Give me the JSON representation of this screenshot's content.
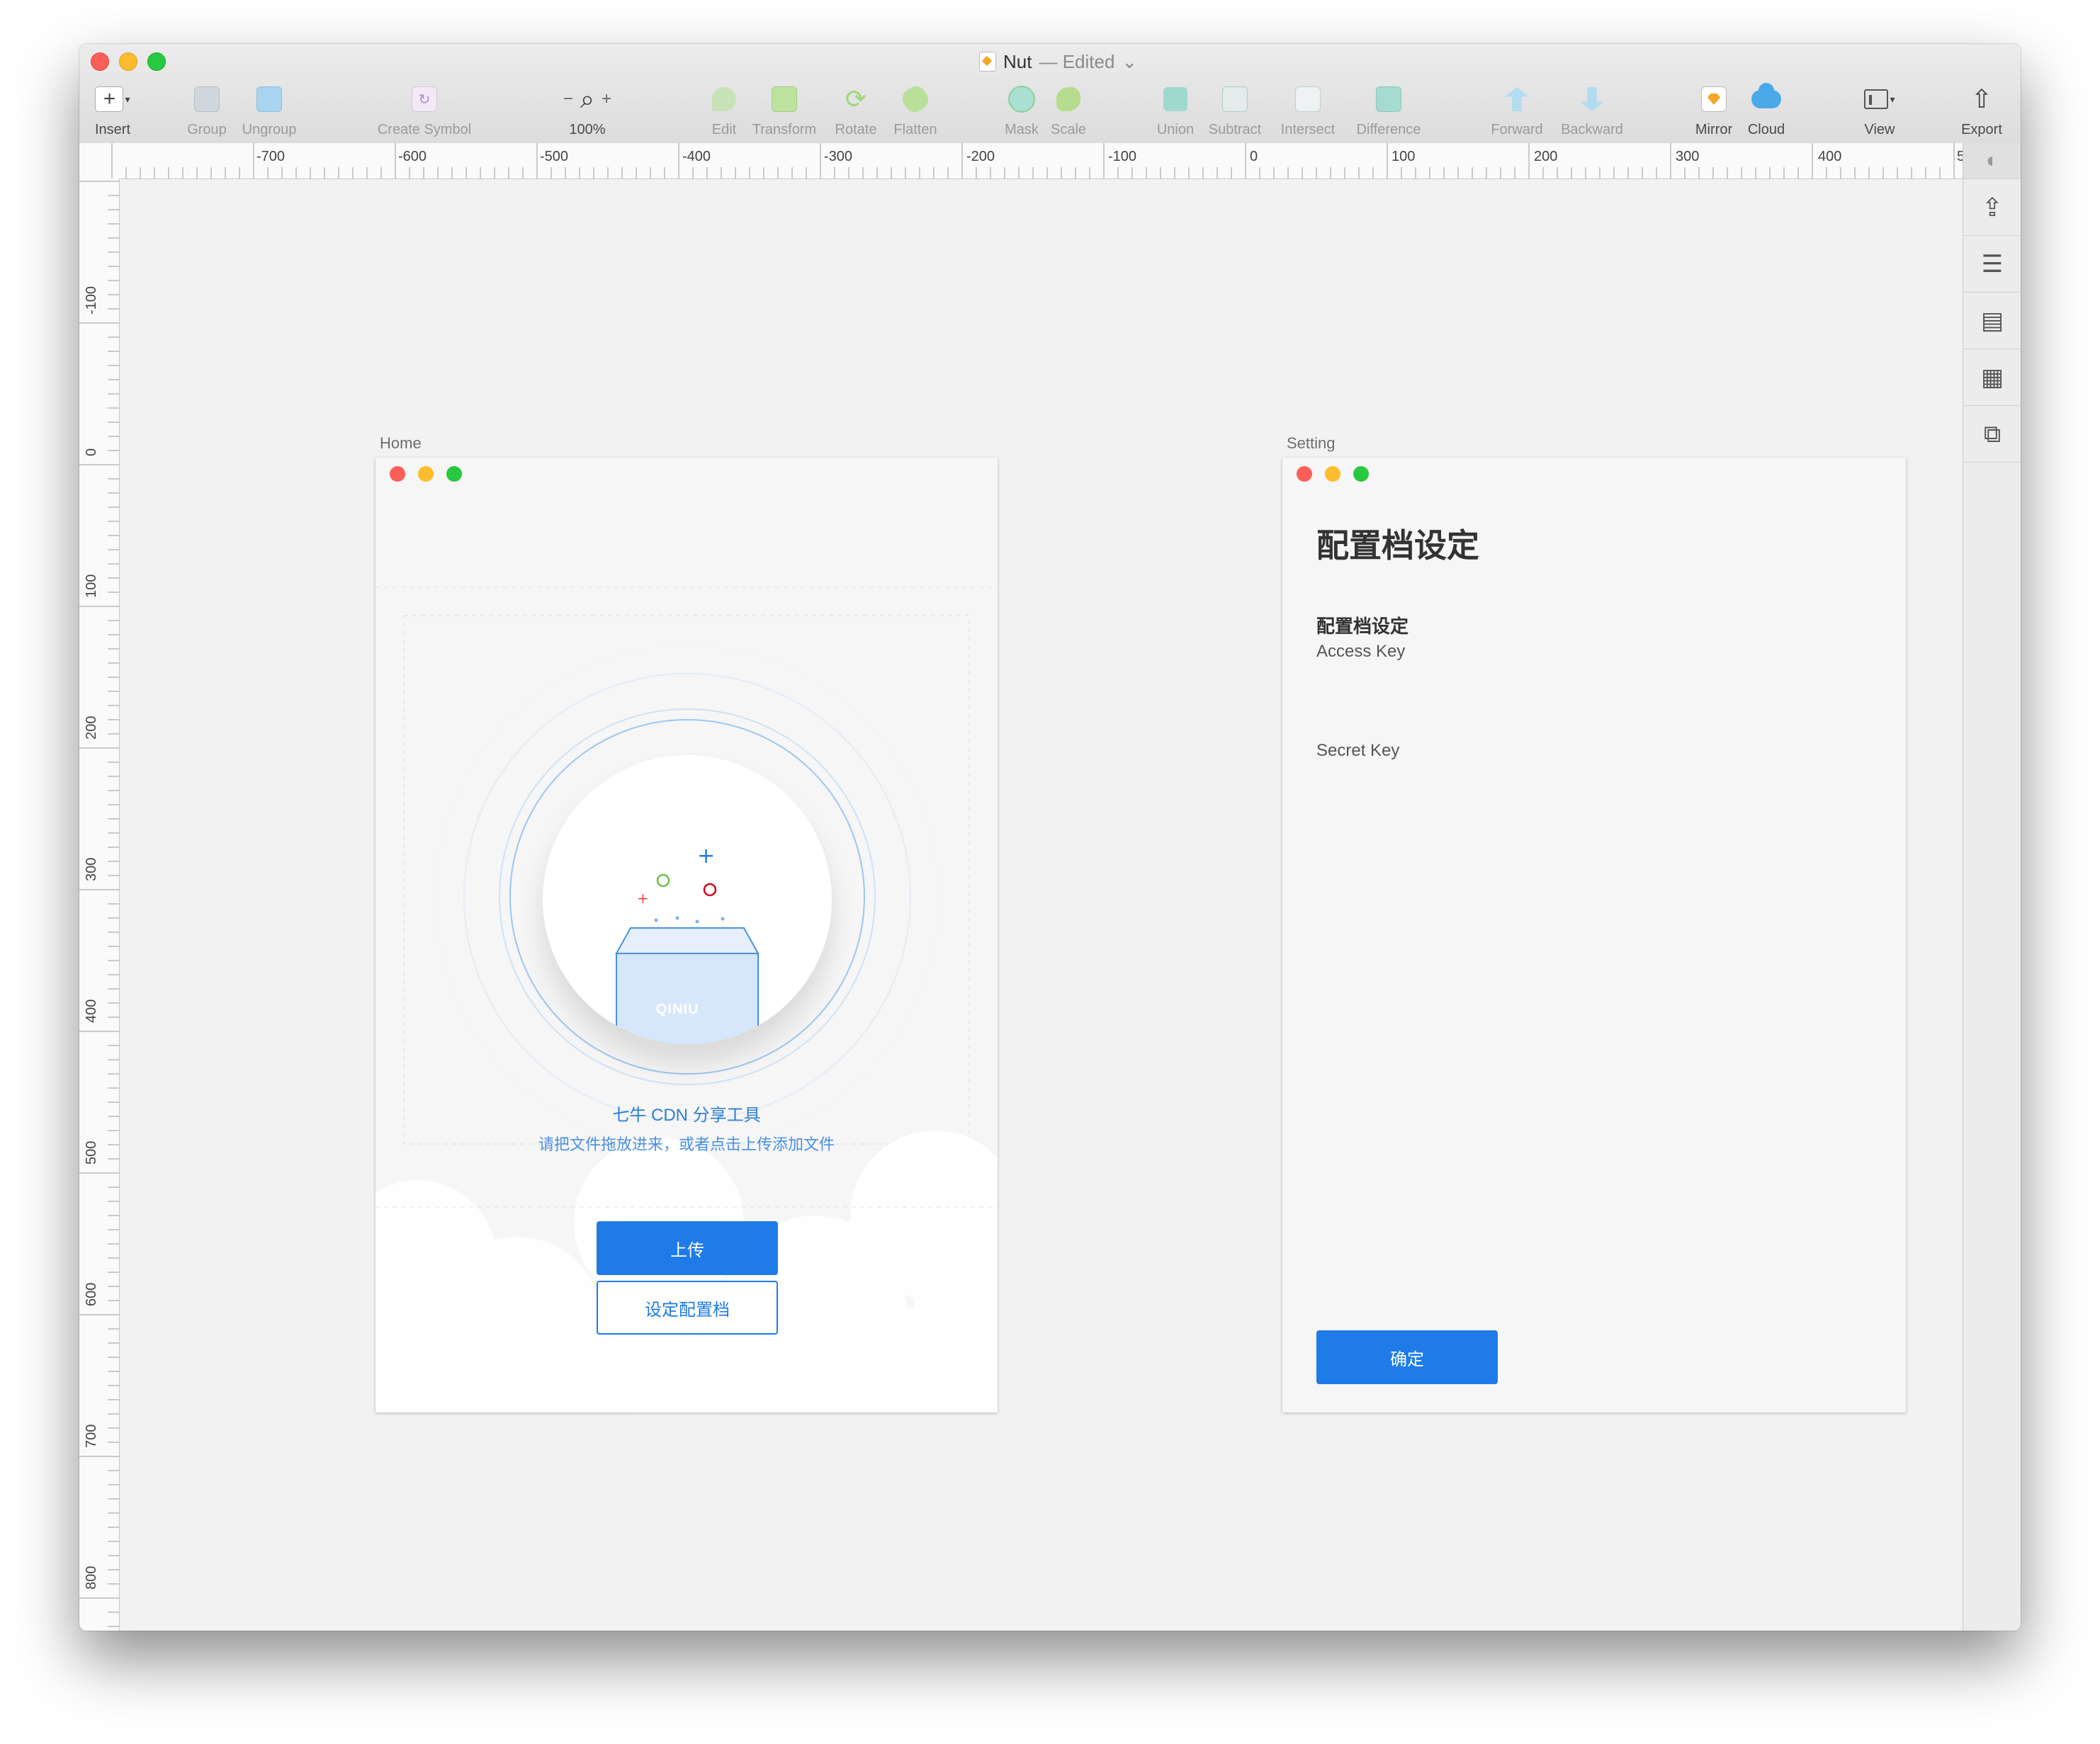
{
  "window": {
    "doc_name": "Nut",
    "doc_status": "— Edited"
  },
  "toolbar": {
    "insert": "Insert",
    "group": "Group",
    "ungroup": "Ungroup",
    "create_symbol": "Create Symbol",
    "zoom_minus": "−",
    "zoom_plus": "+",
    "zoom_level": "100%",
    "edit": "Edit",
    "transform": "Transform",
    "rotate": "Rotate",
    "flatten": "Flatten",
    "mask": "Mask",
    "scale": "Scale",
    "union": "Union",
    "subtract": "Subtract",
    "intersect": "Intersect",
    "difference": "Difference",
    "forward": "Forward",
    "backward": "Backward",
    "mirror": "Mirror",
    "cloud": "Cloud",
    "view": "View",
    "export": "Export"
  },
  "ruler": {
    "h_ticks": [
      "-700",
      "-600",
      "-500",
      "-400",
      "-300",
      "-200",
      "-100",
      "0",
      "100",
      "200",
      "300",
      "400",
      "5"
    ],
    "v_ticks": [
      "-100",
      "0",
      "100",
      "200",
      "300",
      "400",
      "500",
      "600",
      "700",
      "800"
    ]
  },
  "artboards": {
    "home": {
      "label": "Home",
      "app_title": "七牛 CDN 分享工具",
      "hint": "请把文件拖放进来，或者点击上传添加文件",
      "logo_text": "QINIU",
      "upload_button": "上传",
      "settings_button": "设定配置档"
    },
    "setting": {
      "label": "Setting",
      "title": "配置档设定",
      "section_title": "配置档设定",
      "access_key_label": "Access Key",
      "secret_key_label": "Secret Key",
      "confirm_button": "确定"
    }
  },
  "colors": {
    "accent": "#1e7be8",
    "traffic_close": "#fc5f57",
    "traffic_min": "#fdbc2e",
    "traffic_max": "#28c840"
  }
}
